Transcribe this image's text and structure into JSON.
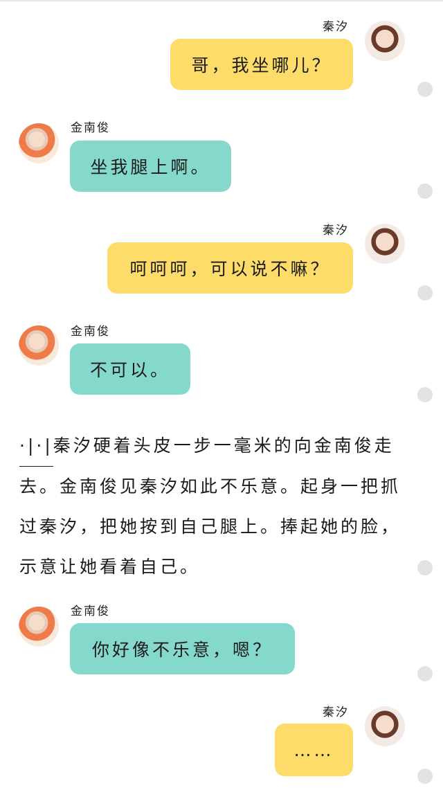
{
  "participants": {
    "female_name": "秦汐",
    "male_name": "金南俊"
  },
  "messages": [
    {
      "sender": "秦汐",
      "text": "哥，我坐哪儿？",
      "side": "right",
      "color": "#fedc6a"
    },
    {
      "sender": "金南俊",
      "text": "坐我腿上啊。",
      "side": "left",
      "color": "#84d9cc"
    },
    {
      "sender": "秦汐",
      "text": "呵呵呵，可以说不嘛？",
      "side": "right",
      "color": "#fedc6a"
    },
    {
      "sender": "金南俊",
      "text": "不可以。",
      "side": "left",
      "color": "#84d9cc"
    },
    {
      "sender": "金南俊",
      "text": "你好像不乐意，嗯？",
      "side": "left",
      "color": "#84d9cc"
    },
    {
      "sender": "秦汐",
      "text": "……",
      "side": "right",
      "color": "#fedc6a"
    }
  ],
  "narration": {
    "mark": "·|·|",
    "text": "秦汐硬着头皮一步一毫米的向金南俊走去。金南俊见秦汐如此不乐意。起身一把抓过秦汐，把她按到自己腿上。捧起她的脸，示意让她看着自己。"
  }
}
